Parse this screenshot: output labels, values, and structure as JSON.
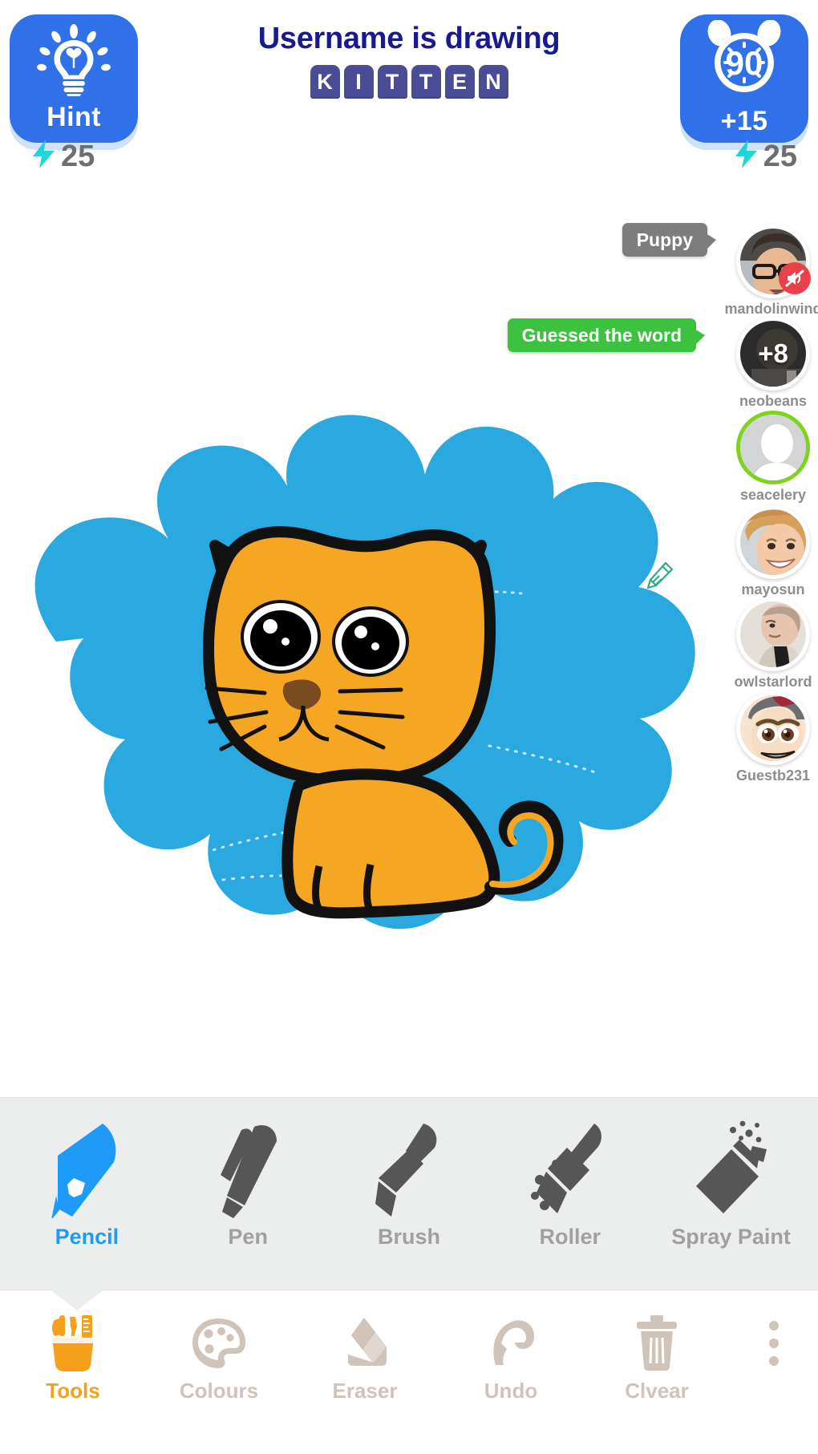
{
  "header": {
    "title": "Username is drawing",
    "word": "KITTEN",
    "word_letters": [
      "K",
      "I",
      "T",
      "T",
      "E",
      "N"
    ],
    "hint_button": {
      "label": "Hint",
      "icon": "lightbulb-icon",
      "energy_cost": "25",
      "energy_icon": "lightning-bolt-icon"
    },
    "timer_button": {
      "seconds": "90",
      "label": "+15",
      "icon": "alarm-clock-icon",
      "energy_cost": "25",
      "energy_icon": "lightning-bolt-icon"
    }
  },
  "colors": {
    "accent_blue": "#3071ea",
    "title_navy": "#181b8f",
    "tile_purple": "#4a4d96",
    "tool_active_blue": "#1d9bf7",
    "nav_active_orange": "#f5a11e",
    "correct_green": "#3cc23f",
    "guess_gray": "#7d7d7d",
    "energy_cyan": "#27d9d2",
    "active_ring_green": "#7ed321",
    "canvas_background": "#2aa8e0",
    "cat_orange": "#f5a623",
    "cat_brown": "#7a4a20"
  },
  "canvas": {
    "drawing_subject": "kitten",
    "drawing_indicator_icon": "pencil-outline-icon"
  },
  "bubbles": [
    {
      "id": "guess",
      "text": "Puppy",
      "type": "guess"
    },
    {
      "id": "correct",
      "text": "Guessed the word",
      "type": "correct"
    }
  ],
  "players": [
    {
      "name": "mandolinwind",
      "avatar": "photo-man-glasses",
      "muted": true,
      "mute_icon": "muted-speaker-icon",
      "score": null,
      "active": false
    },
    {
      "name": "neobeans",
      "avatar": "photo-dark",
      "muted": false,
      "score": "+8",
      "active": false
    },
    {
      "name": "seacelery",
      "avatar": "default-person-icon",
      "muted": false,
      "score": null,
      "active": true
    },
    {
      "name": "mayosun",
      "avatar": "photo-woman-smiling",
      "muted": false,
      "score": null,
      "active": false
    },
    {
      "name": "owlstarlord",
      "avatar": "photo-man-looking-down",
      "muted": false,
      "score": null,
      "active": false
    },
    {
      "name": "Guestb231",
      "avatar": "cartoon-face-cap",
      "muted": false,
      "score": null,
      "active": false
    }
  ],
  "tools": [
    {
      "label": "Pencil",
      "icon": "pencil-icon",
      "selected": true
    },
    {
      "label": "Pen",
      "icon": "pen-icon",
      "selected": false
    },
    {
      "label": "Brush",
      "icon": "brush-icon",
      "selected": false
    },
    {
      "label": "Roller",
      "icon": "paint-roller-icon",
      "selected": false
    },
    {
      "label": "Spray Paint",
      "icon": "spray-can-icon",
      "selected": false
    }
  ],
  "bottom_nav": [
    {
      "label": "Tools",
      "icon": "tools-cup-icon",
      "active": true
    },
    {
      "label": "Colours",
      "icon": "palette-icon",
      "active": false
    },
    {
      "label": "Eraser",
      "icon": "eraser-icon",
      "active": false
    },
    {
      "label": "Undo",
      "icon": "undo-arrow-icon",
      "active": false
    },
    {
      "label": "Clvear",
      "icon": "trash-can-icon",
      "active": false
    }
  ],
  "more_menu": {
    "icon": "three-dots-vertical-icon"
  }
}
